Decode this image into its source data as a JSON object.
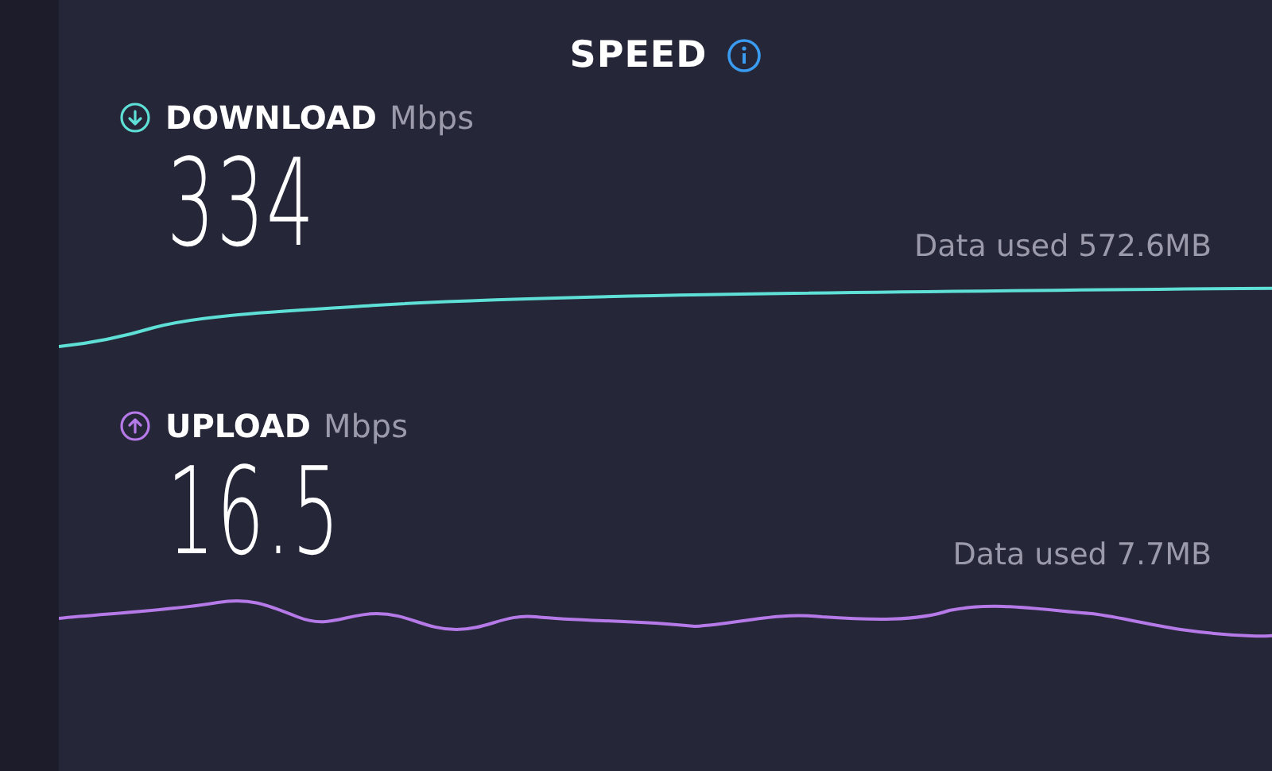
{
  "title": "SPEED",
  "metrics": [
    {
      "kind": "download",
      "label": "DOWNLOAD",
      "unit": "Mbps",
      "value": "334",
      "data_used": "Data used 572.6MB"
    },
    {
      "kind": "upload",
      "label": "UPLOAD",
      "unit": "Mbps",
      "value": "16.5",
      "data_used": "Data used 7.7MB"
    }
  ]
}
